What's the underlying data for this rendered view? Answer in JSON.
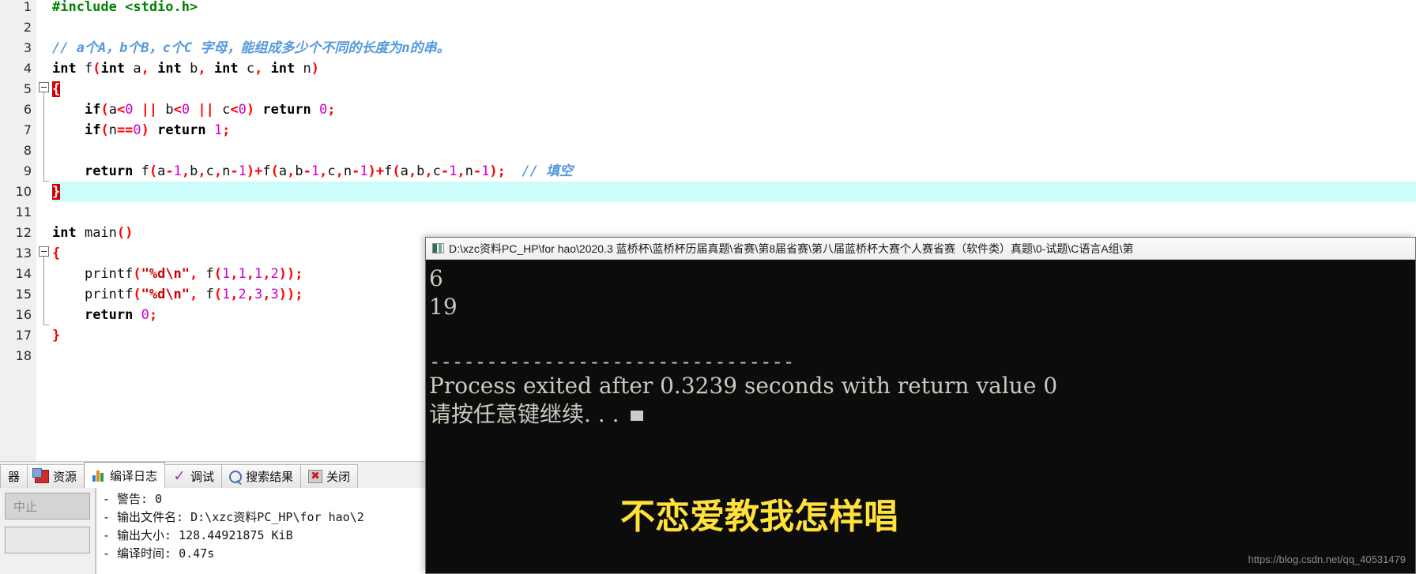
{
  "editor": {
    "lines": [
      {
        "n": "1",
        "segments": [
          {
            "t": "#include <stdio.h>",
            "c": "pp"
          }
        ]
      },
      {
        "n": "2",
        "segments": []
      },
      {
        "n": "3",
        "segments": [
          {
            "t": "// a个A，b个B，c个C 字母，能组成多少个不同的长度为n的串。",
            "c": "cmt"
          }
        ]
      },
      {
        "n": "4",
        "segments": [
          {
            "t": "int",
            "c": "kw"
          },
          {
            "t": " f",
            "c": "pln"
          },
          {
            "t": "(",
            "c": "op"
          },
          {
            "t": "int",
            "c": "kw"
          },
          {
            "t": " a",
            "c": "pln"
          },
          {
            "t": ",",
            "c": "op"
          },
          {
            "t": " ",
            "c": "pln"
          },
          {
            "t": "int",
            "c": "kw"
          },
          {
            "t": " b",
            "c": "pln"
          },
          {
            "t": ",",
            "c": "op"
          },
          {
            "t": " ",
            "c": "pln"
          },
          {
            "t": "int",
            "c": "kw"
          },
          {
            "t": " c",
            "c": "pln"
          },
          {
            "t": ",",
            "c": "op"
          },
          {
            "t": " ",
            "c": "pln"
          },
          {
            "t": "int",
            "c": "kw"
          },
          {
            "t": " n",
            "c": "pln"
          },
          {
            "t": ")",
            "c": "op"
          }
        ]
      },
      {
        "n": "5",
        "segments": [
          {
            "t": "{",
            "c": "brace-hl"
          }
        ]
      },
      {
        "n": "6",
        "segments": [
          {
            "t": "    ",
            "c": "pln"
          },
          {
            "t": "if",
            "c": "kw"
          },
          {
            "t": "(",
            "c": "op"
          },
          {
            "t": "a",
            "c": "pln"
          },
          {
            "t": "<",
            "c": "op"
          },
          {
            "t": "0",
            "c": "num"
          },
          {
            "t": " ",
            "c": "pln"
          },
          {
            "t": "||",
            "c": "op"
          },
          {
            "t": " b",
            "c": "pln"
          },
          {
            "t": "<",
            "c": "op"
          },
          {
            "t": "0",
            "c": "num"
          },
          {
            "t": " ",
            "c": "pln"
          },
          {
            "t": "||",
            "c": "op"
          },
          {
            "t": " c",
            "c": "pln"
          },
          {
            "t": "<",
            "c": "op"
          },
          {
            "t": "0",
            "c": "num"
          },
          {
            "t": ")",
            "c": "op"
          },
          {
            "t": " ",
            "c": "pln"
          },
          {
            "t": "return",
            "c": "kw"
          },
          {
            "t": " ",
            "c": "pln"
          },
          {
            "t": "0",
            "c": "num"
          },
          {
            "t": ";",
            "c": "op"
          }
        ]
      },
      {
        "n": "7",
        "segments": [
          {
            "t": "    ",
            "c": "pln"
          },
          {
            "t": "if",
            "c": "kw"
          },
          {
            "t": "(",
            "c": "op"
          },
          {
            "t": "n",
            "c": "pln"
          },
          {
            "t": "==",
            "c": "op"
          },
          {
            "t": "0",
            "c": "num"
          },
          {
            "t": ")",
            "c": "op"
          },
          {
            "t": " ",
            "c": "pln"
          },
          {
            "t": "return",
            "c": "kw"
          },
          {
            "t": " ",
            "c": "pln"
          },
          {
            "t": "1",
            "c": "num"
          },
          {
            "t": ";",
            "c": "op"
          }
        ]
      },
      {
        "n": "8",
        "segments": []
      },
      {
        "n": "9",
        "segments": [
          {
            "t": "    ",
            "c": "pln"
          },
          {
            "t": "return",
            "c": "kw"
          },
          {
            "t": " f",
            "c": "pln"
          },
          {
            "t": "(",
            "c": "op"
          },
          {
            "t": "a",
            "c": "pln"
          },
          {
            "t": "-",
            "c": "op"
          },
          {
            "t": "1",
            "c": "num"
          },
          {
            "t": ",",
            "c": "op"
          },
          {
            "t": "b",
            "c": "pln"
          },
          {
            "t": ",",
            "c": "op"
          },
          {
            "t": "c",
            "c": "pln"
          },
          {
            "t": ",",
            "c": "op"
          },
          {
            "t": "n",
            "c": "pln"
          },
          {
            "t": "-",
            "c": "op"
          },
          {
            "t": "1",
            "c": "num"
          },
          {
            "t": ")",
            "c": "op"
          },
          {
            "t": "+",
            "c": "op"
          },
          {
            "t": "f",
            "c": "pln"
          },
          {
            "t": "(",
            "c": "op"
          },
          {
            "t": "a",
            "c": "pln"
          },
          {
            "t": ",",
            "c": "op"
          },
          {
            "t": "b",
            "c": "pln"
          },
          {
            "t": "-",
            "c": "op"
          },
          {
            "t": "1",
            "c": "num"
          },
          {
            "t": ",",
            "c": "op"
          },
          {
            "t": "c",
            "c": "pln"
          },
          {
            "t": ",",
            "c": "op"
          },
          {
            "t": "n",
            "c": "pln"
          },
          {
            "t": "-",
            "c": "op"
          },
          {
            "t": "1",
            "c": "num"
          },
          {
            "t": ")",
            "c": "op"
          },
          {
            "t": "+",
            "c": "op"
          },
          {
            "t": "f",
            "c": "pln"
          },
          {
            "t": "(",
            "c": "op"
          },
          {
            "t": "a",
            "c": "pln"
          },
          {
            "t": ",",
            "c": "op"
          },
          {
            "t": "b",
            "c": "pln"
          },
          {
            "t": ",",
            "c": "op"
          },
          {
            "t": "c",
            "c": "pln"
          },
          {
            "t": "-",
            "c": "op"
          },
          {
            "t": "1",
            "c": "num"
          },
          {
            "t": ",",
            "c": "op"
          },
          {
            "t": "n",
            "c": "pln"
          },
          {
            "t": "-",
            "c": "op"
          },
          {
            "t": "1",
            "c": "num"
          },
          {
            "t": ")",
            "c": "op"
          },
          {
            "t": ";",
            "c": "op"
          },
          {
            "t": "  ",
            "c": "pln"
          },
          {
            "t": "// 填空",
            "c": "cmt"
          }
        ]
      },
      {
        "n": "10",
        "segments": [
          {
            "t": "}",
            "c": "brace-hl"
          }
        ]
      },
      {
        "n": "11",
        "segments": []
      },
      {
        "n": "12",
        "segments": [
          {
            "t": "int",
            "c": "kw"
          },
          {
            "t": " main",
            "c": "pln"
          },
          {
            "t": "()",
            "c": "op"
          }
        ]
      },
      {
        "n": "13",
        "segments": [
          {
            "t": "{",
            "c": "op"
          }
        ]
      },
      {
        "n": "14",
        "segments": [
          {
            "t": "    printf",
            "c": "pln"
          },
          {
            "t": "(",
            "c": "op"
          },
          {
            "t": "\"%d\\n\"",
            "c": "str"
          },
          {
            "t": ",",
            "c": "op"
          },
          {
            "t": " f",
            "c": "pln"
          },
          {
            "t": "(",
            "c": "op"
          },
          {
            "t": "1",
            "c": "num"
          },
          {
            "t": ",",
            "c": "op"
          },
          {
            "t": "1",
            "c": "num"
          },
          {
            "t": ",",
            "c": "op"
          },
          {
            "t": "1",
            "c": "num"
          },
          {
            "t": ",",
            "c": "op"
          },
          {
            "t": "2",
            "c": "num"
          },
          {
            "t": "))",
            "c": "op"
          },
          {
            "t": ";",
            "c": "op"
          }
        ]
      },
      {
        "n": "15",
        "segments": [
          {
            "t": "    printf",
            "c": "pln"
          },
          {
            "t": "(",
            "c": "op"
          },
          {
            "t": "\"%d\\n\"",
            "c": "str"
          },
          {
            "t": ",",
            "c": "op"
          },
          {
            "t": " f",
            "c": "pln"
          },
          {
            "t": "(",
            "c": "op"
          },
          {
            "t": "1",
            "c": "num"
          },
          {
            "t": ",",
            "c": "op"
          },
          {
            "t": "2",
            "c": "num"
          },
          {
            "t": ",",
            "c": "op"
          },
          {
            "t": "3",
            "c": "num"
          },
          {
            "t": ",",
            "c": "op"
          },
          {
            "t": "3",
            "c": "num"
          },
          {
            "t": "))",
            "c": "op"
          },
          {
            "t": ";",
            "c": "op"
          }
        ]
      },
      {
        "n": "16",
        "segments": [
          {
            "t": "    ",
            "c": "pln"
          },
          {
            "t": "return",
            "c": "kw"
          },
          {
            "t": " ",
            "c": "pln"
          },
          {
            "t": "0",
            "c": "num"
          },
          {
            "t": ";",
            "c": "op"
          }
        ]
      },
      {
        "n": "17",
        "segments": [
          {
            "t": "}",
            "c": "op"
          }
        ]
      },
      {
        "n": "18",
        "segments": []
      }
    ],
    "highlighted_line": "10",
    "colors": {
      "preprocessor": "#008000",
      "comment": "#5599dd",
      "keyword": "#000000",
      "number": "#cc00cc",
      "string": "#cc0000",
      "operator": "#ff0000",
      "selection": "#ccfcfc",
      "brace_match_bg": "#d40000"
    }
  },
  "console": {
    "icon": "cmd-window-icon",
    "title": "D:\\xzc资料PC_HP\\for hao\\2020.3 蓝桥杯\\蓝桥杯历届真题\\省赛\\第8届省赛\\第八届蓝桥杯大赛个人赛省赛（软件类）真题\\0-试题\\C语言A组\\第",
    "output_lines": [
      "6",
      "19"
    ],
    "separator": "--------------------------------",
    "exit_message": "Process exited after 0.3239 seconds with return value 0",
    "press_any_key": "请按任意键继续. . .",
    "overlay_text": "不恋爱教我怎样唱",
    "overlay_color": "#ffe13b",
    "watermark": "https://blog.csdn.net/qq_40531479"
  },
  "bottom_panel": {
    "tabs": [
      {
        "label": "器",
        "icon": "partial-tab-icon",
        "active": false
      },
      {
        "label": "资源",
        "icon": "resources-icon",
        "active": false
      },
      {
        "label": "编译日志",
        "icon": "compile-log-icon",
        "active": true
      },
      {
        "label": "调试",
        "icon": "debug-check-icon",
        "active": false
      },
      {
        "label": "搜索结果",
        "icon": "search-results-icon",
        "active": false
      },
      {
        "label": "关闭",
        "icon": "close-icon",
        "active": false
      }
    ],
    "buttons": [
      {
        "label": "中止",
        "enabled": false
      },
      {
        "label": "",
        "enabled": false
      }
    ],
    "log_lines": [
      "- 警告: 0",
      "- 输出文件名: D:\\xzc资料PC_HP\\for hao\\2",
      "- 输出大小: 128.44921875 KiB",
      "- 编译时间: 0.47s"
    ]
  }
}
